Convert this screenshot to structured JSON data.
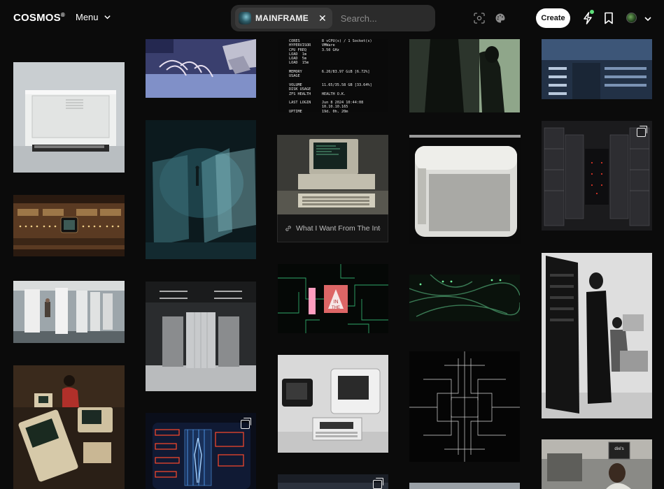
{
  "app": {
    "logo": "COSMOS",
    "logo_mark": "®"
  },
  "header": {
    "menu_label": "Menu",
    "search": {
      "chip_label": "MAINFRAME",
      "placeholder": "Search..."
    },
    "create_label": "Create"
  },
  "icons": {
    "menu_caret": "chevron-down-icon",
    "chip_close": "close-icon",
    "visual_search": "scan-icon",
    "palette": "palette-icon",
    "activity": "lightning-icon",
    "bookmark": "bookmark-icon",
    "avatar_caret": "chevron-down-icon",
    "link": "link-icon",
    "stack": "stack-icon"
  },
  "colors": {
    "background": "#0b0b0b",
    "search_bg": "#2b2b2b",
    "notification_dot": "#5ee07a"
  },
  "link_card": {
    "title": "What I Want From The Inte..."
  },
  "terminal_text": {
    "lines": [
      "CORES          8 vCPU(s) / 1 Socket(s)",
      "HYPERVISOR     VMWare",
      "CPU FREQ       3.50 GHz",
      "LOAD  1m",
      "LOAD  5m",
      "LOAD  15m",
      "",
      "MEMORY         6.20/83.97 GiB [6.72%]",
      "USAGE",
      "",
      "VOLUME         11.65/35.58 GB [33.64%]",
      "DISK USAGE",
      "ZFS HEALTH     HEALTH O.K.",
      "",
      "LAST LOGIN     Jun 8 2024 10:44:08",
      "               10.10.10.165",
      "UPTIME         19d, 0h, 20m"
    ]
  },
  "poster_text": {
    "sign_line1": "IN",
    "sign_line2": "THE"
  },
  "tv_label": "dixi's"
}
